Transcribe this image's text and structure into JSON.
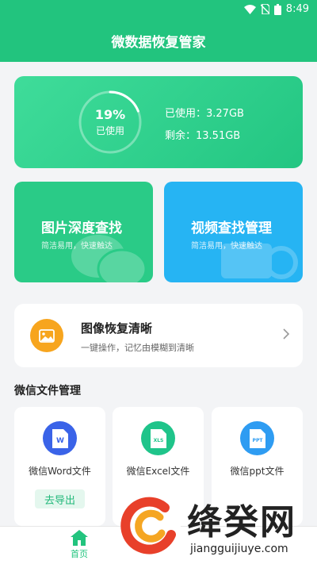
{
  "status": {
    "time": "8:49"
  },
  "app": {
    "title": "微数据恢复管家"
  },
  "storage": {
    "percent": "19%",
    "percent_value": 0.19,
    "used_caption": "已使用",
    "used_line": "已使用：3.27GB",
    "remaining_line": "剩余：13.51GB"
  },
  "features": [
    {
      "title": "图片深度查找",
      "subtitle": "简洁易用，快速触达",
      "color": "#2acb87"
    },
    {
      "title": "视频查找管理",
      "subtitle": "简洁易用，快速触达",
      "color": "#26b4f3"
    }
  ],
  "restore": {
    "title": "图像恢复清晰",
    "subtitle": "一键操作，记忆由模糊到清晰"
  },
  "section": {
    "title": "微信文件管理"
  },
  "files": [
    {
      "badge": "W",
      "label": "微信Word文件",
      "color": "#3a63e8"
    },
    {
      "badge": "XLS",
      "label": "微信Excel文件",
      "color": "#1fc48a"
    },
    {
      "badge": "PPT",
      "label": "微信ppt文件",
      "color": "#2e9cf2"
    }
  ],
  "export": {
    "label": "去导出"
  },
  "nav": {
    "home_label": "首页"
  },
  "watermark": {
    "brand": "绛癸网",
    "url": "jiangguijiuye.com"
  }
}
